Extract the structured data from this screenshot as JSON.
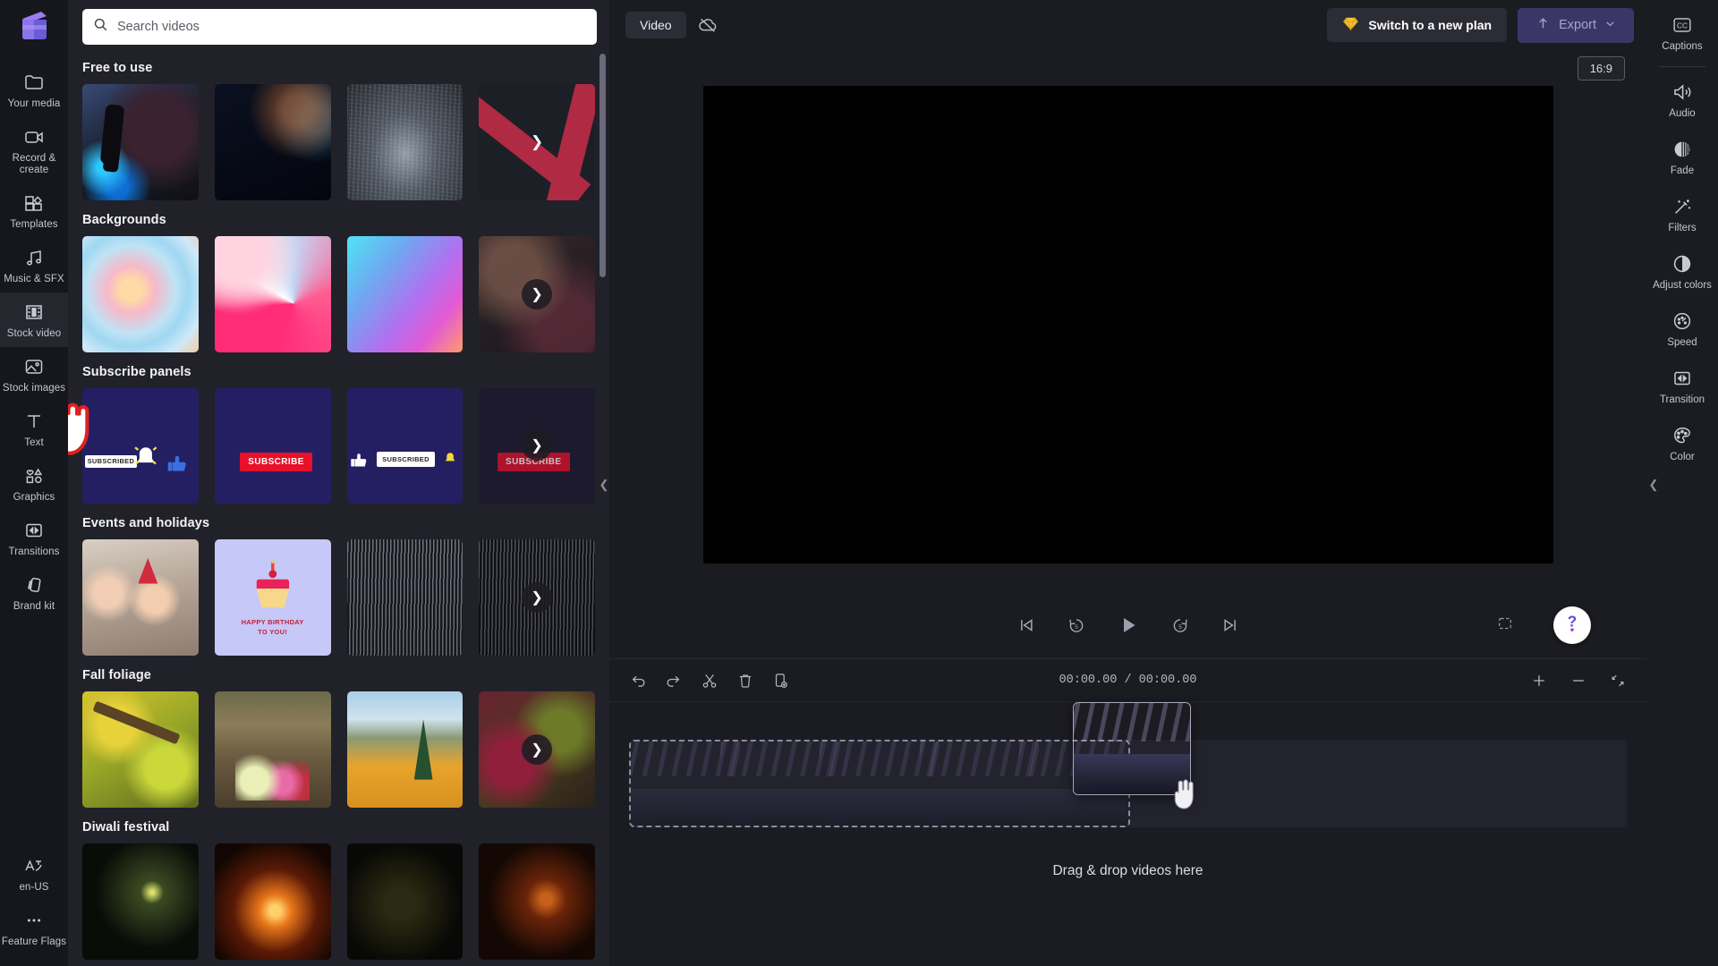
{
  "app": {
    "logo_name": "clipchamp-logo"
  },
  "left_rail": {
    "items": [
      {
        "label": "Your media",
        "icon": "folder-icon",
        "active": false
      },
      {
        "label": "Record & create",
        "icon": "video-camera-icon",
        "active": false
      },
      {
        "label": "Templates",
        "icon": "templates-icon",
        "active": false
      },
      {
        "label": "Music & SFX",
        "icon": "music-note-icon",
        "active": false
      },
      {
        "label": "Stock video",
        "icon": "film-strip-icon",
        "active": true
      },
      {
        "label": "Stock images",
        "icon": "image-icon",
        "active": false
      },
      {
        "label": "Text",
        "icon": "text-icon",
        "active": false
      },
      {
        "label": "Graphics",
        "icon": "graphics-icon",
        "active": false
      },
      {
        "label": "Transitions",
        "icon": "transitions-icon",
        "active": false
      },
      {
        "label": "Brand kit",
        "icon": "brand-kit-icon",
        "active": false
      }
    ],
    "bottom": [
      {
        "label": "en-US",
        "icon": "language-icon"
      },
      {
        "label": "Feature Flags",
        "icon": "ellipsis-icon"
      }
    ]
  },
  "search": {
    "placeholder": "Search videos",
    "value": "",
    "icon": "search-icon"
  },
  "media_panel": {
    "collapse_icon": "chevron-left-icon",
    "sections": [
      {
        "title": "Free to use",
        "thumbs": [
          {
            "name": "podcast-microphone-video",
            "art": "a1"
          },
          {
            "name": "dark-bokeh-video",
            "art": "a2"
          },
          {
            "name": "concrete-texture-video",
            "art": "a3"
          },
          {
            "name": "red-geometric-video",
            "art": "a4",
            "more": true,
            "more_style": "plain"
          }
        ]
      },
      {
        "title": "Backgrounds",
        "thumbs": [
          {
            "name": "pastel-swirl-background",
            "art": "b1"
          },
          {
            "name": "pink-ribbon-3d-background",
            "art": "b2"
          },
          {
            "name": "cyan-purple-gradient-background",
            "art": "b3"
          },
          {
            "name": "dark-warm-gradient-background",
            "art": "b4",
            "more": true,
            "more_style": "circle"
          }
        ]
      },
      {
        "title": "Subscribe panels",
        "thumbs": [
          {
            "name": "subscribed-bell-panel",
            "art": "s1",
            "chip": "SUBSCRIBED",
            "chip_type": "white"
          },
          {
            "name": "subscribe-red-panel",
            "art": "s2",
            "chip": "SUBSCRIBE",
            "chip_type": "red"
          },
          {
            "name": "subscribed-thumbs-up-panel",
            "art": "s3",
            "chip": "SUBSCRIBED",
            "chip_type": "white"
          },
          {
            "name": "subscribe-dark-panel",
            "art": "s4",
            "chip": "SUBSCRIBE",
            "chip_type": "red",
            "more": true,
            "more_style": "circle"
          }
        ]
      },
      {
        "title": "Events and holidays",
        "thumbs": [
          {
            "name": "birthday-party-blowers-video",
            "art": "e1"
          },
          {
            "name": "happy-birthday-cupcake-card",
            "art": "e2",
            "card_text_1": "HAPPY BIRTHDAY",
            "card_text_2": "TO YOU!"
          },
          {
            "name": "silver-tinsel-curtain-video",
            "art": "e3"
          },
          {
            "name": "dark-tinsel-video",
            "art": "e4",
            "more": true,
            "more_style": "circle"
          }
        ]
      },
      {
        "title": "Fall foliage",
        "thumbs": [
          {
            "name": "yellow-autumn-branches-video",
            "art": "f1"
          },
          {
            "name": "family-sitting-autumn-forest-video",
            "art": "f2"
          },
          {
            "name": "mountain-autumn-pine-video",
            "art": "f3"
          },
          {
            "name": "red-autumn-canopy-video",
            "art": "f4",
            "more": true,
            "more_style": "circle"
          }
        ]
      },
      {
        "title": "Diwali festival",
        "thumbs": [
          {
            "name": "sparkler-night-video",
            "art": "d1"
          },
          {
            "name": "fireworks-burst-video",
            "art": "d2"
          },
          {
            "name": "dark-diya-video",
            "art": "d3"
          },
          {
            "name": "firework-trails-video",
            "art": "d4"
          }
        ]
      }
    ]
  },
  "topbar": {
    "project_name": "Video",
    "cloud_icon": "cloud-offline-icon",
    "plan_label": "Switch to a new plan",
    "plan_icon": "diamond-icon",
    "export_label": "Export",
    "export_icon": "upload-icon",
    "export_chevron": "chevron-down-icon"
  },
  "stage": {
    "aspect_ratio": "16:9",
    "controls": [
      {
        "name": "skip-to-start-button",
        "icon": "skip-start-icon"
      },
      {
        "name": "rewind-5-button",
        "icon": "rewind-5-icon",
        "label": "5"
      },
      {
        "name": "play-button",
        "icon": "play-icon"
      },
      {
        "name": "forward-5-button",
        "icon": "forward-5-icon",
        "label": "5"
      },
      {
        "name": "skip-to-end-button",
        "icon": "skip-end-icon"
      }
    ],
    "fullscreen_icon": "fullscreen-icon",
    "help_icon": "question-mark-icon"
  },
  "timeline": {
    "tools": [
      {
        "name": "undo-button",
        "icon": "undo-icon"
      },
      {
        "name": "redo-button",
        "icon": "redo-icon"
      },
      {
        "name": "split-button",
        "icon": "scissors-icon"
      },
      {
        "name": "delete-button",
        "icon": "trash-icon"
      },
      {
        "name": "duplicate-button",
        "icon": "duplicate-icon"
      }
    ],
    "timecode": "00:00.00 / 00:00.00",
    "zoom_in_icon": "plus-icon",
    "zoom_out_icon": "minus-icon",
    "fit_icon": "fit-to-screen-icon",
    "drop_hint": "Drag & drop videos here",
    "dragging_clip": "aurora-mountain-clip"
  },
  "right_rail": {
    "captions": {
      "label": "Captions",
      "icon": "closed-captions-icon"
    },
    "collapse_icon": "chevron-left-icon",
    "items": [
      {
        "label": "Audio",
        "icon": "speaker-icon"
      },
      {
        "label": "Fade",
        "icon": "fade-circle-icon"
      },
      {
        "label": "Filters",
        "icon": "magic-wand-icon"
      },
      {
        "label": "Adjust colors",
        "icon": "half-circle-icon"
      },
      {
        "label": "Speed",
        "icon": "speedometer-icon"
      },
      {
        "label": "Transition",
        "icon": "transition-icon"
      },
      {
        "label": "Color",
        "icon": "palette-icon"
      }
    ]
  },
  "colors": {
    "accent_purple": "#6b5cd6",
    "plan_diamond": "#f2c230",
    "panel_bg": "#21212a",
    "rail_bg": "#16161d",
    "stage_bg": "#1b1b22",
    "cursor_outline": "#e02020"
  }
}
